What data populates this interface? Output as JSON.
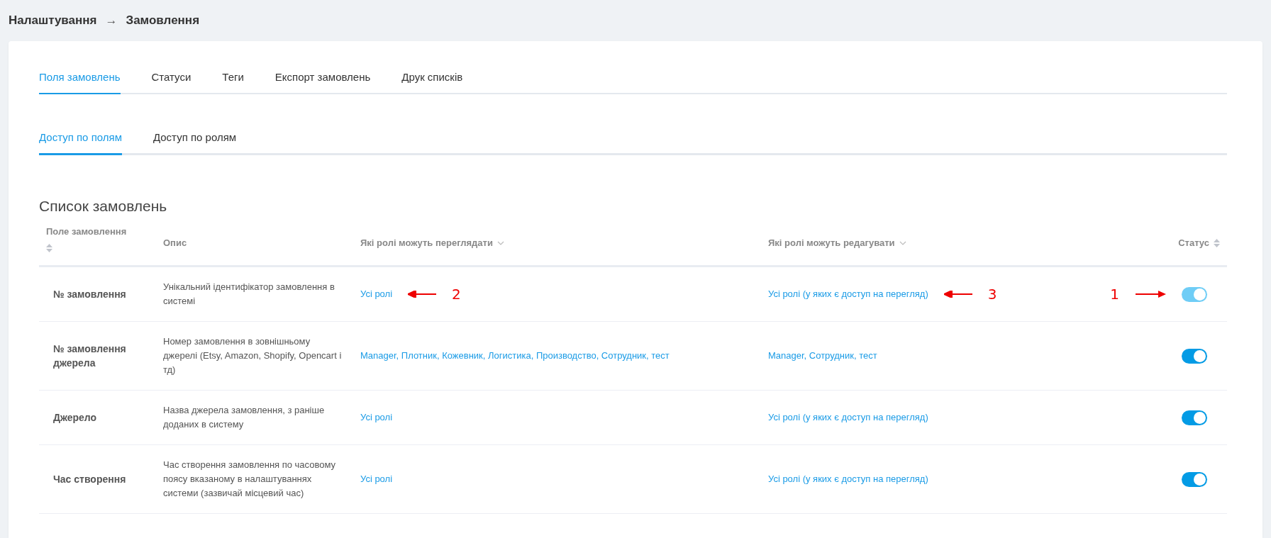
{
  "breadcrumb": {
    "parent": "Налаштування",
    "separator": "→",
    "current": "Замовлення"
  },
  "tabs": [
    {
      "label": "Поля замовлень",
      "selected": true
    },
    {
      "label": "Статуси",
      "selected": false
    },
    {
      "label": "Теги",
      "selected": false
    },
    {
      "label": "Експорт замовлень",
      "selected": false
    },
    {
      "label": "Друк списків",
      "selected": false
    }
  ],
  "subtabs": [
    {
      "label": "Доступ по полям",
      "selected": true
    },
    {
      "label": "Доступ по ролям",
      "selected": false
    }
  ],
  "section_title": "Список замовлень",
  "table": {
    "columns": [
      {
        "label": "Поле замовлення",
        "kind": "sort"
      },
      {
        "label": "Опис",
        "kind": "plain"
      },
      {
        "label": "Які ролі можуть переглядати",
        "kind": "dropdown"
      },
      {
        "label": "Які ролі можуть редагувати",
        "kind": "dropdown"
      },
      {
        "label": "Статус",
        "kind": "sort"
      }
    ],
    "rows": [
      {
        "field": "№ замовлення",
        "description": "Унікальний ідентифікатор замовлення в системі",
        "view_roles": "Усі ролі",
        "edit_roles": "Усі ролі (у яких є доступ на перегляд)",
        "on": true,
        "disabled": true,
        "view_marker": "2",
        "edit_marker": "3",
        "status_marker": "1"
      },
      {
        "field": "№ замовлення джерела",
        "description": "Номер замовлення в зовнішньому джерелі (Etsy, Amazon, Shopify, Opencart і тд)",
        "view_roles": "Manager, Плотник, Кожевник, Логистика, Производство, Сотрудник, тест",
        "edit_roles": "Manager, Сотрудник, тест",
        "on": true,
        "disabled": false
      },
      {
        "field": "Джерело",
        "description": "Назва джерела замовлення, з раніше доданих в систему",
        "view_roles": "Усі ролі",
        "edit_roles": "Усі ролі (у яких є доступ на перегляд)",
        "on": true,
        "disabled": false
      },
      {
        "field": "Час створення",
        "description": "Час створення замовлення по часовому поясу вказаному в налаштуваннях системи (зазвичай місцевий час)",
        "view_roles": "Усі ролі",
        "edit_roles": "Усі ролі (у яких є доступ на перегляд)",
        "on": true,
        "disabled": false
      }
    ]
  }
}
